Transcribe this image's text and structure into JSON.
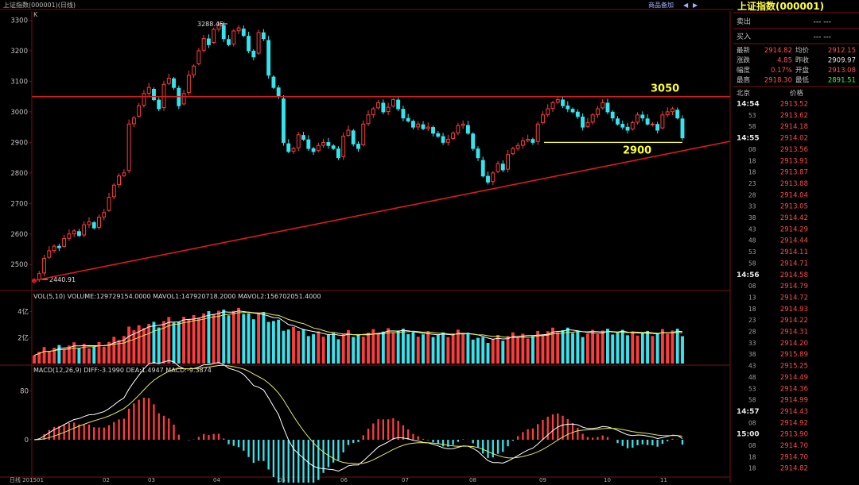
{
  "window": {
    "title": "上证指数(000001)(日线)",
    "toolbar_links": [
      "商品备加",
      "◀",
      "▶"
    ],
    "unit_marker": "K"
  },
  "quote_panel": {
    "title": "上证指数(000001)",
    "sell_label": "卖出",
    "buy_label": "买入",
    "sell_value": "---  ---",
    "buy_value": "---  ---",
    "stats": [
      {
        "label": "最新",
        "value": "2914.82",
        "color": "#ff5050",
        "label2": "均价",
        "value2": "2912.15",
        "color2": "#ff5050"
      },
      {
        "label": "涨跌",
        "value": "4.85",
        "color": "#ff5050",
        "label2": "昨收",
        "value2": "2909.97",
        "color2": "#e0e0e0"
      },
      {
        "label": "幅度",
        "value": "0.17%",
        "color": "#ff5050",
        "label2": "开盘",
        "value2": "2913.08",
        "color2": "#ff5050"
      },
      {
        "label": "最高",
        "value": "2918.30",
        "color": "#ff5050",
        "label2": "最低",
        "value2": "2891.51",
        "color2": "#30ff30"
      }
    ],
    "ticks_header": {
      "left": "北京",
      "right": "价格"
    },
    "ticks": [
      {
        "time": "14:54",
        "price": "2913.52"
      },
      {
        "time": "53",
        "price": "2913.62"
      },
      {
        "time": "58",
        "price": "2914.18"
      },
      {
        "time": "14:55",
        "price": "2914.02"
      },
      {
        "time": "08",
        "price": "2913.56"
      },
      {
        "time": "18",
        "price": "2913.91"
      },
      {
        "time": "18",
        "price": "2913.87"
      },
      {
        "time": "23",
        "price": "2913.88"
      },
      {
        "time": "28",
        "price": "2914.04"
      },
      {
        "time": "33",
        "price": "2913.05"
      },
      {
        "time": "38",
        "price": "2914.42"
      },
      {
        "time": "43",
        "price": "2914.29"
      },
      {
        "time": "48",
        "price": "2914.44"
      },
      {
        "time": "53",
        "price": "2914.11"
      },
      {
        "time": "58",
        "price": "2914.71"
      },
      {
        "time": "14:56",
        "price": "2914.58"
      },
      {
        "time": "08",
        "price": "2914.79"
      },
      {
        "time": "13",
        "price": "2914.72"
      },
      {
        "time": "18",
        "price": "2914.93"
      },
      {
        "time": "23",
        "price": "2914.22"
      },
      {
        "time": "28",
        "price": "2914.31"
      },
      {
        "time": "33",
        "price": "2914.20"
      },
      {
        "time": "38",
        "price": "2915.89"
      },
      {
        "time": "43",
        "price": "2915.25"
      },
      {
        "time": "48",
        "price": "2914.49"
      },
      {
        "time": "53",
        "price": "2914.36"
      },
      {
        "time": "58",
        "price": "2914.99"
      },
      {
        "time": "14:57",
        "price": "2914.43"
      },
      {
        "time": "08",
        "price": "2914.92"
      },
      {
        "time": "15:00",
        "price": "2913.90"
      },
      {
        "time": "08",
        "price": "2914.70"
      },
      {
        "time": "18",
        "price": "2914.70"
      },
      {
        "time": "18",
        "price": "2914.82"
      }
    ]
  },
  "chart_data": [
    {
      "type": "candlestick",
      "panel": "price",
      "ylim": [
        2420,
        3330
      ],
      "y_ticks": [
        2500,
        2600,
        2700,
        2800,
        2900,
        3000,
        3100,
        3200,
        3300
      ],
      "x_tick_labels": [
        "日线 201501",
        "02",
        "03",
        "04",
        "05",
        "06",
        "07",
        "08",
        "09",
        "10",
        "11"
      ],
      "series_close": [
        2450,
        2470,
        2520,
        2545,
        2560,
        2555,
        2585,
        2600,
        2610,
        2595,
        2630,
        2640,
        2620,
        2655,
        2670,
        2720,
        2760,
        2790,
        2800,
        2960,
        2980,
        3020,
        3060,
        3080,
        3040,
        3010,
        3090,
        3110,
        3080,
        3020,
        3060,
        3120,
        3150,
        3200,
        3240,
        3220,
        3270,
        3285,
        3240,
        3220,
        3265,
        3275,
        3250,
        3200,
        3180,
        3260,
        3240,
        3120,
        3080,
        3050,
        2900,
        2870,
        2880,
        2925,
        2910,
        2880,
        2870,
        2890,
        2900,
        2890,
        2880,
        2850,
        2920,
        2940,
        2895,
        2880,
        2960,
        2990,
        3010,
        3030,
        3000,
        3015,
        3040,
        3010,
        2980,
        2970,
        2950,
        2960,
        2945,
        2950,
        2930,
        2920,
        2900,
        2910,
        2930,
        2955,
        2960,
        2930,
        2880,
        2850,
        2790,
        2770,
        2800,
        2830,
        2810,
        2860,
        2880,
        2890,
        2905,
        2910,
        2900,
        2960,
        2990,
        3010,
        3030,
        3040,
        3020,
        3010,
        3000,
        2985,
        2950,
        2965,
        2990,
        3010,
        3030,
        3000,
        2980,
        2960,
        2950,
        2940,
        2965,
        2990,
        2980,
        2960,
        2960,
        2940,
        2990,
        3000,
        3010,
        2980,
        2915
      ],
      "annotations": [
        {
          "text": "3288.45",
          "note": "high"
        },
        {
          "text": "2440.91",
          "note": "low"
        },
        {
          "text": "3050",
          "value": 3050
        },
        {
          "text": "2900",
          "value": 2900
        }
      ]
    },
    {
      "type": "bar",
      "panel": "volume",
      "indicator_label": "VOL(5,10) VOLUME:129729154.0000  MAVOL1:147920718.2000  MAVOL2:156702051.4000",
      "y_tick_labels": [
        "4亿",
        "2亿"
      ],
      "y_ticks": [
        4,
        2
      ],
      "unit": "亿",
      "ylim": [
        0,
        5.5
      ]
    },
    {
      "type": "bar",
      "panel": "macd",
      "indicator_label": "MACD(12,26,9) DIFF:-3.1990  DEA:1.4947  MACD:-9.3874",
      "y_tick_labels": [
        "80",
        "0"
      ],
      "y_ticks": [
        80,
        0
      ],
      "ylim": [
        -60,
        120
      ]
    }
  ],
  "colors": {
    "up": "#ff3c3c",
    "down": "#33e5ee",
    "grid_red": "#7a1010",
    "annotation_yellow": "#ffff33",
    "trend_line": "#e01a1a",
    "ma1": "#ffffff",
    "ma2": "#e8e85a"
  }
}
